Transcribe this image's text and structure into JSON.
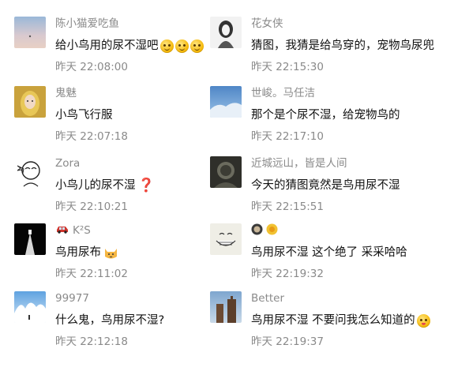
{
  "comments": [
    {
      "name": "陈小猫爱吃鱼",
      "content": "给小鸟用的尿不湿吧",
      "time": "昨天 22:08:00"
    },
    {
      "name": "花女侠",
      "content": "猜图，我猜是给鸟穿的，宠物鸟尿兜",
      "time": "昨天 22:15:30"
    },
    {
      "name": "鬼魅",
      "content": "小鸟飞行服",
      "time": "昨天 22:07:18"
    },
    {
      "name": "世峻。马任洁",
      "content": "那个是个尿不湿，给宠物鸟的",
      "time": "昨天 22:17:10"
    },
    {
      "name": "Zora",
      "content": "小鸟儿的尿不湿",
      "time": "昨天 22:10:21"
    },
    {
      "name": "近城远山，皆是人间",
      "content": "今天的猜图竟然是鸟用尿不湿",
      "time": "昨天 22:15:51"
    },
    {
      "name": "K²S",
      "content": "鸟用尿布",
      "time": "昨天 22:11:02"
    },
    {
      "name": "",
      "content": "鸟用尿不湿  这个绝了 采采哈哈",
      "time": "昨天 22:19:32"
    },
    {
      "name": "99977",
      "content": "什么鬼，鸟用尿不湿?",
      "time": "昨天 22:12:18"
    },
    {
      "name": "Better",
      "content": "鸟用尿不湿 不要问我怎么知道的",
      "time": "昨天 22:19:37"
    }
  ],
  "icons": {
    "emoji_smile": "smiling-face-emoji",
    "emoji_tongue": "tongue-out-emoji",
    "question": "red-question-mark",
    "car": "car-icon",
    "cat": "cat-face-emoji",
    "name_faces": "round-face-icons"
  },
  "colors": {
    "name": "#8a8a8a",
    "content": "#111111",
    "time": "#8a8a8a",
    "question": "#d0021b"
  }
}
